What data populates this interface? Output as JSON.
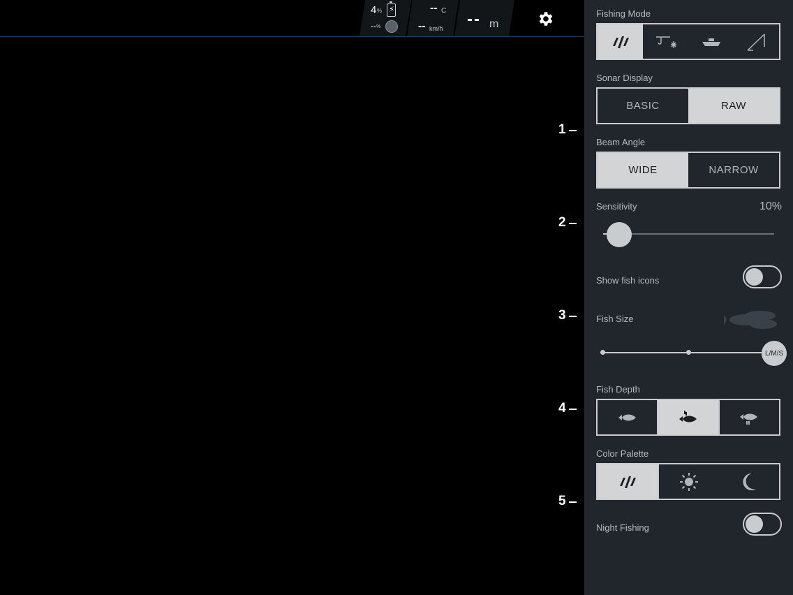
{
  "status": {
    "battery_value": "4",
    "battery_unit": "%",
    "signal_value": "--",
    "signal_unit": "%",
    "temperature_value": "--",
    "temperature_unit": "C",
    "speed_value": "--",
    "speed_unit": "km/h",
    "depth_value": "--",
    "depth_unit": "m"
  },
  "depth_scale": [
    "1",
    "2",
    "3",
    "4",
    "5"
  ],
  "settings": {
    "fishing_mode": {
      "label": "Fishing Mode",
      "options": [
        "sonar-logo-icon",
        "ice-fishing-icon",
        "boat-icon",
        "shore-fishing-icon"
      ],
      "selected": 0
    },
    "sonar_display": {
      "label": "Sonar Display",
      "options": [
        "BASIC",
        "RAW"
      ],
      "selected": "RAW"
    },
    "beam_angle": {
      "label": "Beam Angle",
      "options": [
        "WIDE",
        "NARROW"
      ],
      "selected": "WIDE"
    },
    "sensitivity": {
      "label": "Sensitivity",
      "value_text": "10%",
      "value": 0.1
    },
    "show_fish_icons": {
      "label": "Show fish icons",
      "on": false
    },
    "fish_size": {
      "label": "Fish Size",
      "knob_label": "L/M/S"
    },
    "fish_depth": {
      "label": "Fish Depth",
      "options": [
        "fish-shallow-icon",
        "fish-middle-icon",
        "fish-deep-icon"
      ],
      "selected": 1
    },
    "color_palette": {
      "label": "Color Palette",
      "options": [
        "sonar-logo-icon",
        "sun-icon",
        "moon-icon"
      ],
      "selected": 0
    },
    "night_fishing": {
      "label": "Night Fishing",
      "on": false
    }
  },
  "colors": {
    "panel_bg": "#20262c",
    "selected_bg": "#d3d4d5",
    "border": "#c9ccce",
    "label": "#b4bac0"
  }
}
